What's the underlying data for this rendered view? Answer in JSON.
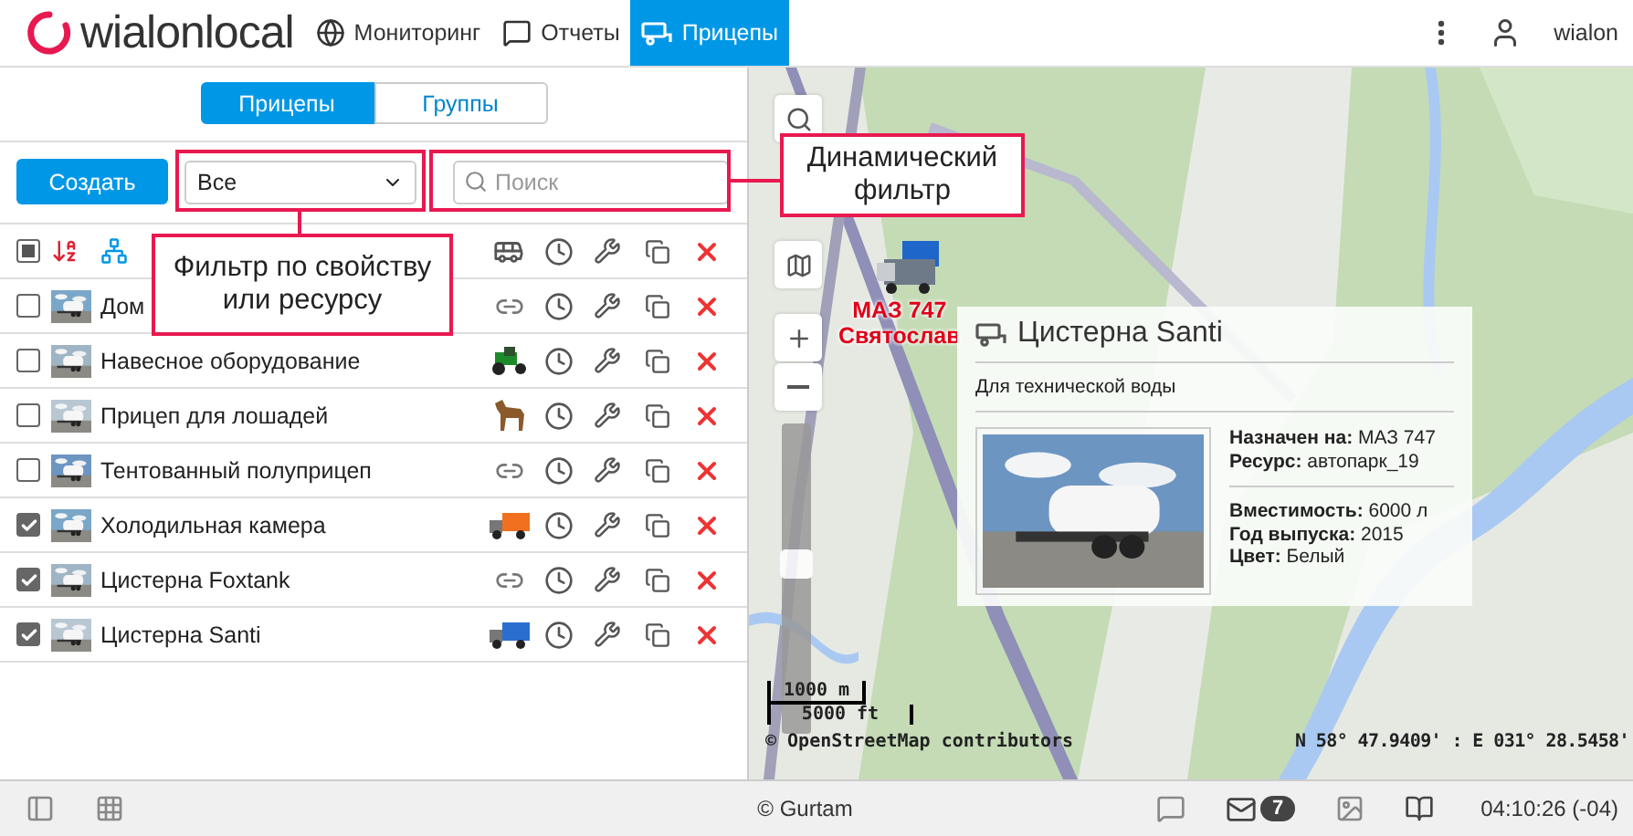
{
  "header": {
    "logo": "wialonlocal",
    "nav": [
      {
        "label": "Мониторинг",
        "selected": false
      },
      {
        "label": "Отчеты",
        "selected": false
      },
      {
        "label": "Прицепы",
        "selected": true
      }
    ],
    "user": "wialon"
  },
  "panel": {
    "tabs": [
      {
        "label": "Прицепы",
        "selected": true
      },
      {
        "label": "Группы",
        "selected": false
      }
    ],
    "create_button": "Создать",
    "filter": {
      "value": "Все"
    },
    "search": {
      "placeholder": "Поиск"
    },
    "select_all": {
      "indeterminate": true
    },
    "rows": [
      {
        "name": "Дом",
        "checked": false,
        "assigned": {
          "kind": "link"
        }
      },
      {
        "name": "Навесное оборудование",
        "checked": false,
        "assigned": {
          "kind": "tractor"
        }
      },
      {
        "name": "Прицеп для лошадей",
        "checked": false,
        "assigned": {
          "kind": "horse"
        }
      },
      {
        "name": "Тентованный полуприцеп",
        "checked": false,
        "assigned": {
          "kind": "link"
        }
      },
      {
        "name": "Холодильная камера",
        "checked": true,
        "assigned": {
          "kind": "truck",
          "color": "#f07020"
        }
      },
      {
        "name": "Цистерна Foxtank",
        "checked": true,
        "assigned": {
          "kind": "link"
        }
      },
      {
        "name": "Цистерна Santi",
        "checked": true,
        "assigned": {
          "kind": "truck",
          "color": "#2a6fd0"
        }
      }
    ]
  },
  "map": {
    "zoom": {
      "level": 0.55
    },
    "unit": {
      "name": "МАЗ 747",
      "driver": "Святослав"
    },
    "popup": {
      "title": "Цистерна Santi",
      "description": "Для технической воды",
      "info": [
        "**Назначен на:** МАЗ 747",
        "**Ресурс:** автопарк_19"
      ],
      "properties": [
        "**Вместимость:** 6000 л",
        "**Год выпуска:** 2015",
        "**Цвет:** Белый"
      ]
    },
    "scale": [
      "1000 m",
      "5000 ft"
    ],
    "attribution": "© OpenStreetMap contributors",
    "coordinates": "N 58° 47.9409' : E 031° 28.5458'"
  },
  "annotations": [
    {
      "text": "Фильтр по свойству или ресурсу"
    },
    {
      "text": "Динамический фильтр"
    }
  ],
  "footer": {
    "copyright": "© Gurtam",
    "messages": "7",
    "time": "04:10:26 (-04)"
  }
}
